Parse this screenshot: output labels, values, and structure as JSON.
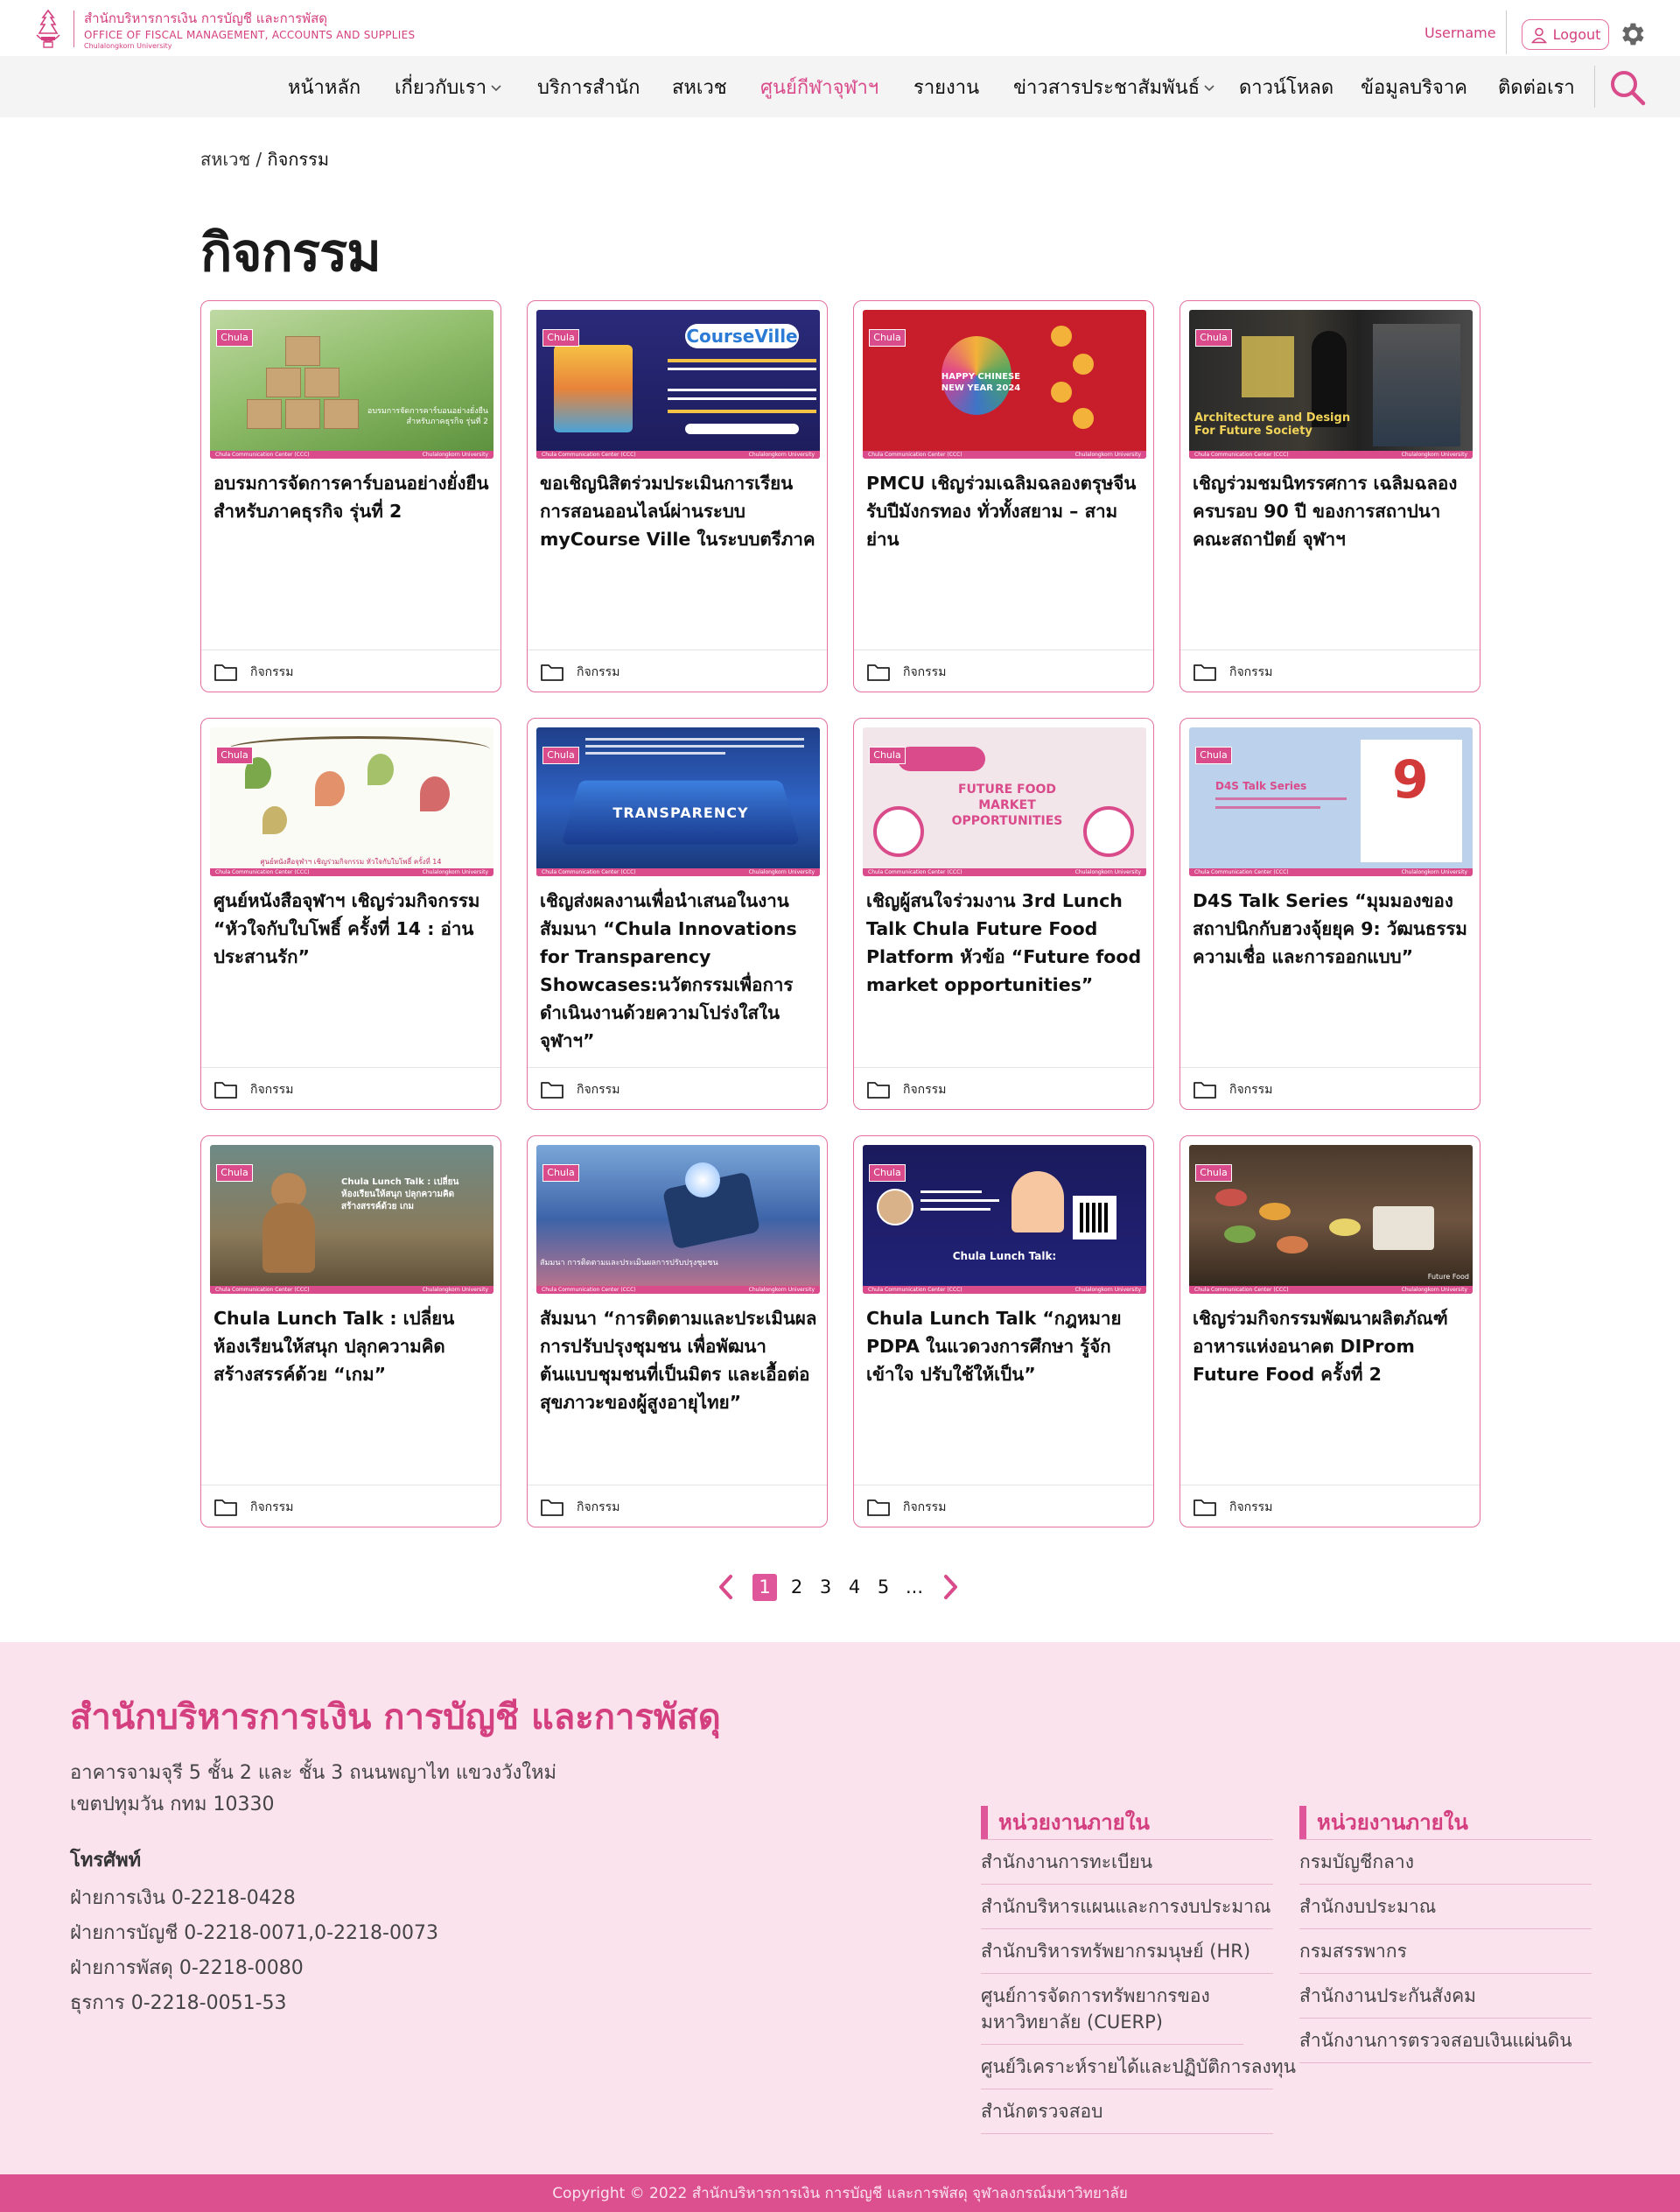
{
  "header": {
    "org_th": "สำนักบริหารการเงิน การบัญชี และการพัสดุ",
    "org_en": "OFFICE OF FISCAL MANAGEMENT, ACCOUNTS AND SUPPLIES",
    "org_uni": "Chulalongkorn University",
    "username": "Username",
    "logout_label": "Logout"
  },
  "nav": {
    "items": [
      {
        "label": "หน้าหลัก"
      },
      {
        "label": "เกี่ยวกับเรา"
      },
      {
        "label": "บริการสำนัก"
      },
      {
        "label": "สหเวช"
      },
      {
        "label": "ศูนย์กีฬาจุฬาฯ"
      },
      {
        "label": "รายงาน"
      },
      {
        "label": "ข่าวสารประชาสัมพันธ์"
      },
      {
        "label": "ดาวน์โหลด"
      },
      {
        "label": "ข้อมูลบริจาค"
      },
      {
        "label": "ติดต่อเรา"
      }
    ],
    "active_index": 4
  },
  "breadcrumb": {
    "parent": "สหเวช",
    "sep": " / ",
    "current": "กิจกรรม"
  },
  "page_title": "กิจกรรม",
  "card_common": {
    "strip_left": "Chula Communication Center (CCC)",
    "strip_right": "Chulalongkorn University",
    "badge": "Chula"
  },
  "cards": [
    {
      "title": "อบรมการจัดการคาร์บอนอย่างยั่งยืนสำหรับภาคธุรกิจ รุ่นที่ 2",
      "category": "กิจกรรม",
      "image_text": "อบรมการจัดการคาร์บอนอย่างยั่งยืนสำหรับภาคธุรกิจ รุ่นที่ 2"
    },
    {
      "title": "ขอเชิญนิสิตร่วมประเมินการเรียนการสอนออนไลน์ผ่านระบบ myCourse Ville ในระบบตรีภาค",
      "category": "กิจกรรม",
      "image_text": "CourseVille"
    },
    {
      "title": "PMCU เชิญร่วมเฉลิมฉลองตรุษจีนรับปีมังกรทอง ทั่วทั้งสยาม – สามย่าน",
      "category": "กิจกรรม",
      "image_text": "HAPPY CHINESE NEW YEAR 2024"
    },
    {
      "title": "เชิญร่วมชมนิทรรศการ เฉลิมฉลองครบรอบ 90 ปี ของการสถาปนาคณะสถาปัตย์ จุฬาฯ",
      "category": "กิจกรรม",
      "image_text": "Architecture and Design For Future Society"
    },
    {
      "title": "ศูนย์หนังสือจุฬาฯ เชิญร่วมกิจกรรม “หัวใจกับใบโพธิ์ ครั้งที่ 14 :  อ่านประสานรัก”",
      "category": "กิจกรรม",
      "image_text": "ศูนย์หนังสือจุฬาฯ เชิญร่วมกิจกรรม หัวใจกับใบโพธิ์ ครั้งที่ 14"
    },
    {
      "title": "เชิญส่งผลงานเพื่อนำเสนอในงานสัมมนา “Chula Innovations for Transparency Showcases:นวัตกรรมเพื่อการดำเนินงานด้วยความโปร่งใสในจุฬาฯ”",
      "category": "กิจกรรม",
      "image_text": "TRANSPARENCY"
    },
    {
      "title": "เชิญผู้สนใจร่วมงาน 3rd Lunch Talk Chula Future Food Platform หัวข้อ “Future food market opportunities”",
      "category": "กิจกรรม",
      "image_text": "FUTURE FOOD MARKET OPPORTUNITIES"
    },
    {
      "title": "D4S Talk Series “มุมมองของสถาปนิกกับฮวงจุ้ยยุค 9: วัฒนธรรม ความเชื่อ และการออกแบบ”",
      "category": "กิจกรรม",
      "image_text": "D4S Talk Series"
    },
    {
      "title": "Chula Lunch Talk : เปลี่ยนห้องเรียนให้สนุก ปลุกความคิดสร้างสรรค์ด้วย “เกม”",
      "category": "กิจกรรม",
      "image_text": "Chula Lunch Talk : เปลี่ยนห้องเรียนให้สนุก ปลุกความคิดสร้างสรรค์ด้วย เกม"
    },
    {
      "title": "สัมมนา “การติดตามและประเมินผลการปรับปรุงชุมชน เพื่อพัฒนาต้นแบบชุมชนที่เป็นมิตร และเอื้อต่อสุขภาวะของผู้สูงอายุไทย”",
      "category": "กิจกรรม",
      "image_text": "สัมมนา การติดตามและประเมินผลการปรับปรุงชุมชน"
    },
    {
      "title": "Chula Lunch Talk “กฎหมาย PDPA ในแวดวงการศึกษา รู้จัก เข้าใจ ปรับใช้ให้เป็น”",
      "category": "กิจกรรม",
      "image_text": "Chula Lunch Talk:"
    },
    {
      "title": "เชิญร่วมกิจกรรมพัฒนาผลิตภัณฑ์อาหารแห่งอนาคต DIProm Future Food ครั้งที่ 2",
      "category": "กิจกรรม",
      "image_text": "Future Food"
    }
  ],
  "pagination": {
    "pages": [
      "1",
      "2",
      "3",
      "4",
      "5",
      "..."
    ],
    "current": 1
  },
  "footer": {
    "title": "สำนักบริหารการเงิน การบัญชี และการพัสดุ",
    "address_line1": "อาคารจามจุรี 5 ชั้น 2 และ ชั้น 3 ถนนพญาไท แขวงวังใหม่",
    "address_line2": "เขตปทุมวัน กทม 10330",
    "phone_heading": "โทรศัพท์",
    "phones": [
      "ฝ่ายการเงิน 0-2218-0428",
      "ฝ่ายการบัญชี 0-2218-0071,0-2218-0073",
      "ฝ่ายการพัสดุ 0-2218-0080",
      "ธุรการ 0-2218-0051-53"
    ],
    "col1": {
      "heading": "หน่วยงานภายใน",
      "links": [
        "สำนักงานการทะเบียน",
        "สำนักบริหารแผนและการงบประมาณ",
        "สำนักบริหารทรัพยากรมนุษย์ (HR)",
        "ศูนย์การจัดการทรัพยากรของมหาวิทยาลัย (CUERP)",
        "ศูนย์วิเคราะห์รายได้และปฏิบัติการลงทุน",
        "สำนักตรวจสอบ"
      ]
    },
    "col2": {
      "heading": "หน่วยงานภายใน",
      "links": [
        "กรมบัญชีกลาง",
        "สำนักงบประมาณ",
        "กรมสรรพากร",
        "สำนักงานประกันสังคม",
        "สำนักงานการตรวจสอบเงินแผ่นดิน"
      ]
    },
    "copyright": "Copyright © 2022 สำนักบริหารการเงิน การบัญชี และการพัสดุ จุฬาลงกรณ์มหาวิทยาลัย"
  },
  "colors": {
    "accent": "#d94b8a",
    "footer_bg": "#fbe3ee",
    "nav_bg": "#f4f4f4"
  }
}
